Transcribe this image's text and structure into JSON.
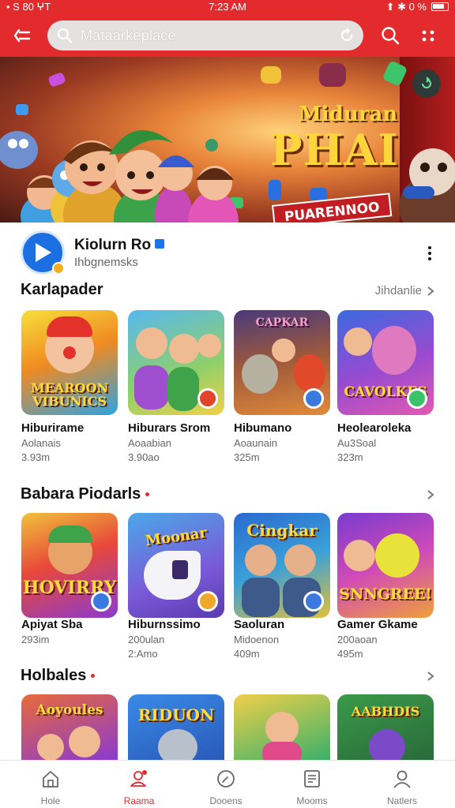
{
  "status_bar": {
    "left": "• S 80   ⵖT",
    "time": "7:23 AM",
    "right": "⬆ ✱ 0 %"
  },
  "app_bar": {
    "search_text": "Mataarkeplace"
  },
  "banner": {
    "title_line1": "Miduran",
    "title_line2": "PHAI",
    "ribbon": "PUARENNOO"
  },
  "channel": {
    "name": "Kiolurn Ro",
    "subtitle": "Ihbgnemsks"
  },
  "sections": [
    {
      "title": "Karlapader",
      "more": "Jihdanlie",
      "items": [
        {
          "caption": "MEAROON VIBUNICS",
          "title": "Hiburirame",
          "sub1": "Aolanais",
          "sub2": "3.93m"
        },
        {
          "caption": "",
          "title": "Hiburars Srom",
          "sub1": "Aoaabian",
          "sub2": "3.90ao"
        },
        {
          "caption": "CAPKAR",
          "title": "Hibumano",
          "sub1": "Aoaunain",
          "sub2": "325m"
        },
        {
          "caption": "CAVOLKES",
          "title": "Heolearoleka",
          "sub1": "Au3Soal",
          "sub2": "323m"
        }
      ]
    },
    {
      "title": "Babara Piodarls",
      "more": "",
      "items": [
        {
          "caption": "HOVIRRY",
          "title": "Apiyat Sba",
          "sub1": "293im",
          "sub2": ""
        },
        {
          "caption": "Moonar",
          "title": "Hiburnssimo",
          "sub1": "200ulan",
          "sub2": "2:Amo"
        },
        {
          "caption": "Cingkar",
          "title": "Saoluran",
          "sub1": "Midoenon",
          "sub2": "409m"
        },
        {
          "caption": "SNNGREE!",
          "title": "Gamer Gkame",
          "sub1": "200aoan",
          "sub2": "495m"
        }
      ]
    },
    {
      "title": "Holbales",
      "more": "",
      "items": [
        {
          "caption": "Aoyoules"
        },
        {
          "caption": "RIDUON"
        },
        {
          "caption": ""
        },
        {
          "caption": "AABHDIS"
        }
      ]
    }
  ],
  "bottom_nav": [
    {
      "label": "Hole",
      "icon": "home-icon",
      "active": false
    },
    {
      "label": "Raama",
      "icon": "profile-icon",
      "active": true
    },
    {
      "label": "Dooens",
      "icon": "compass-icon",
      "active": false
    },
    {
      "label": "Mooms",
      "icon": "document-icon",
      "active": false
    },
    {
      "label": "Natlers",
      "icon": "person-icon",
      "active": false
    }
  ],
  "colors": {
    "brand": "#e32b2e",
    "active_tab": "#e32b2e"
  }
}
